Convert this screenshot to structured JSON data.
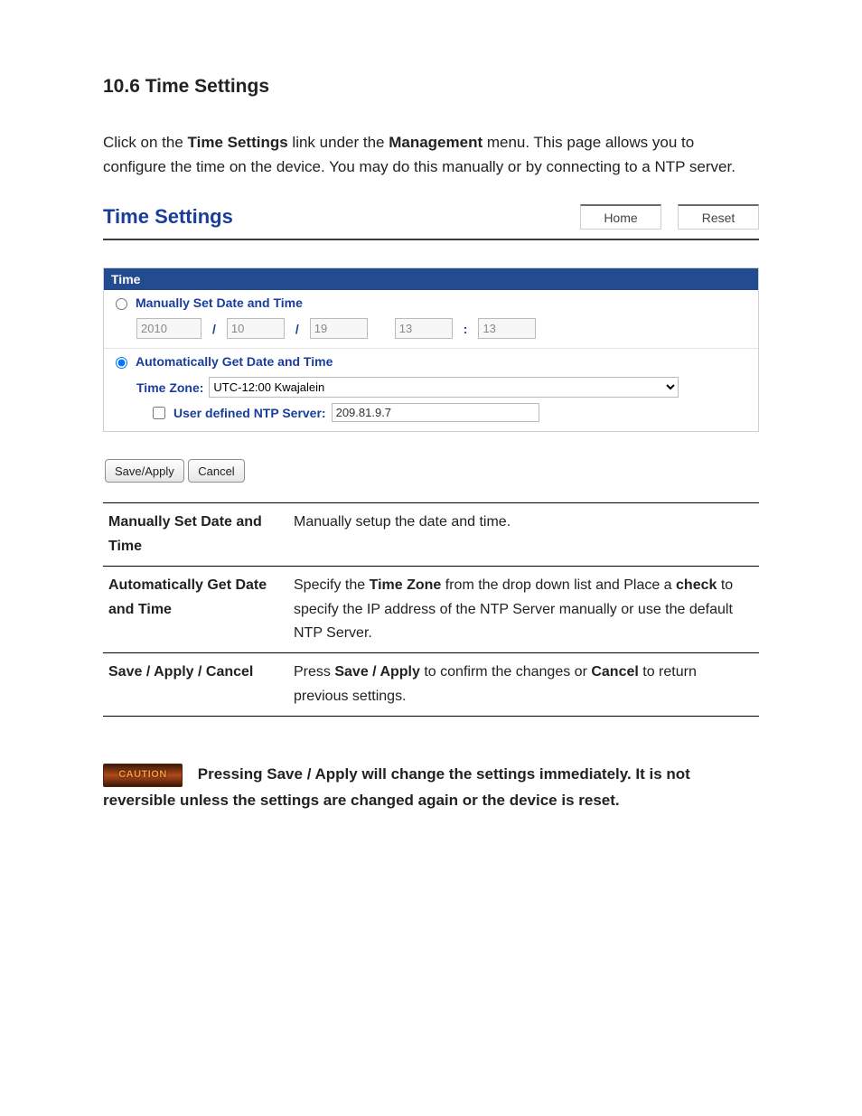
{
  "doc": {
    "heading": "10.6 Time Settings",
    "intro_before_bold1": "Click on the ",
    "intro_bold1": "Time Settings",
    "intro_mid1": " link under the ",
    "intro_bold2": "Management",
    "intro_after": " menu. This page allows you to configure the time on the device. You may do this manually or by connecting to a NTP server."
  },
  "panel": {
    "title": "Time Settings",
    "home_label": "Home",
    "reset_label": "Reset",
    "box_header": "Time",
    "manual_label": "Manually Set Date and Time",
    "year": "2010",
    "month": "10",
    "day": "19",
    "hour": "13",
    "minute": "13",
    "auto_label": "Automatically Get Date and Time",
    "tz_label": "Time Zone:",
    "tz_value": "UTC-12:00 Kwajalein",
    "ntp_label": "User defined NTP Server:",
    "ntp_value": "209.81.9.7",
    "save_apply_label": "Save/Apply",
    "cancel_label": "Cancel"
  },
  "desc": {
    "row1_label": "Manually Set Date and Time",
    "row1_text": "Manually setup the date and time.",
    "row2_label": "Automatically Get Date and Time",
    "row2_pre": "Specify the ",
    "row2_b1": "Time Zone",
    "row2_mid": " from the drop down list and Place a ",
    "row2_b2": "check",
    "row2_post": " to specify the IP address of the NTP Server manually or use the default NTP Server.",
    "row3_label": "Save / Apply / Cancel",
    "row3_pre": "Press ",
    "row3_b1": "Save / Apply",
    "row3_mid": " to confirm the changes or ",
    "row3_b2": "Cancel",
    "row3_post": " to return previous settings."
  },
  "caution": {
    "badge": "CAUTION",
    "text": "Pressing Save / Apply will change the settings immediately. It is not reversible unless the settings are changed again or the device is reset."
  }
}
